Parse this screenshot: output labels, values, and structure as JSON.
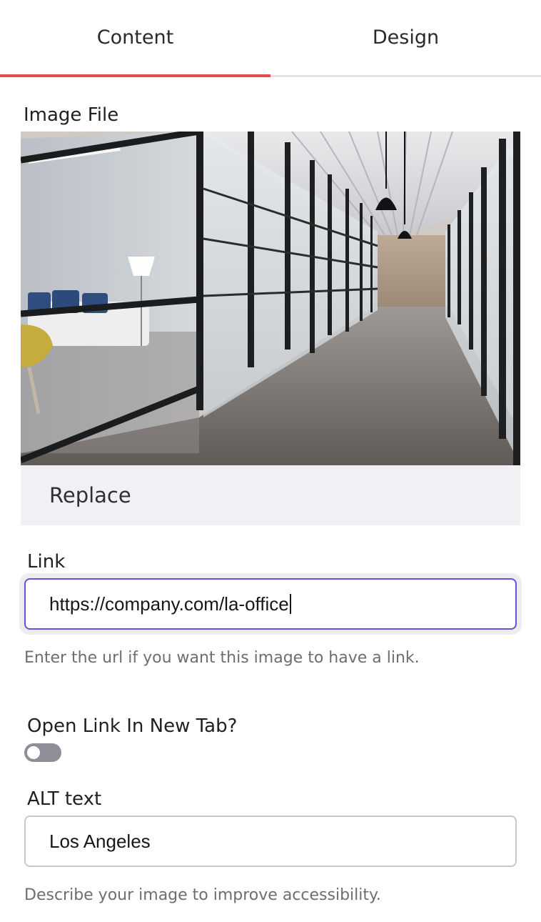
{
  "tabs": {
    "content_label": "Content",
    "design_label": "Design",
    "active": "Content",
    "accent_color": "#e0504f"
  },
  "image_section": {
    "label": "Image File",
    "image_subject": "modern office corridor with glass partition walls",
    "replace_label": "Replace"
  },
  "link_field": {
    "label": "Link",
    "value": "https://company.com/la-office",
    "help": "Enter the url if you want this image to have a link.",
    "focus_color": "#6b4fd8"
  },
  "new_tab": {
    "label": "Open Link In New Tab?",
    "enabled": false
  },
  "alt_field": {
    "label": "ALT text",
    "value": "Los Angeles",
    "help": "Describe your image to improve accessibility."
  }
}
